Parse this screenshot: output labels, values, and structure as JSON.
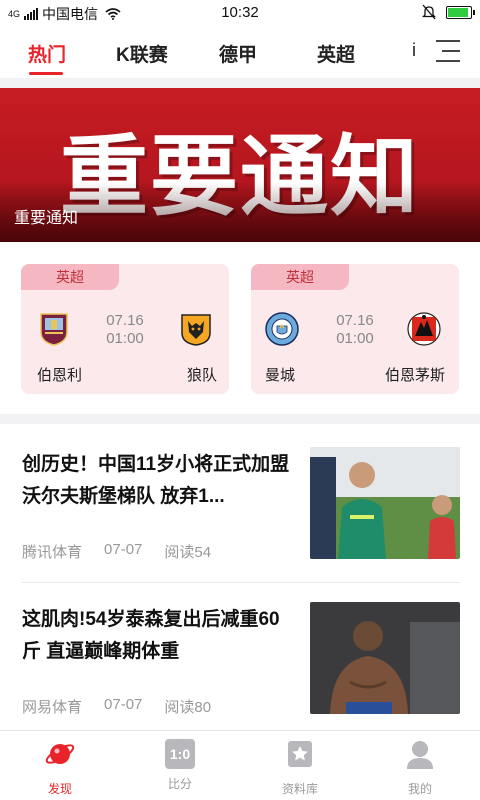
{
  "status_bar": {
    "network": "4G",
    "carrier": "中国电信",
    "time": "10:32"
  },
  "tabs": [
    {
      "label": "热门",
      "active": true
    },
    {
      "label": "K联赛",
      "active": false
    },
    {
      "label": "德甲",
      "active": false
    },
    {
      "label": "英超",
      "active": false
    },
    {
      "label": "i",
      "active": false
    }
  ],
  "banner": {
    "big_text": "重要通知",
    "caption": "重要通知"
  },
  "matches": [
    {
      "league": "英超",
      "home": "伯恩利",
      "away": "狼队",
      "date": "07.16",
      "time": "01:00"
    },
    {
      "league": "英超",
      "home": "曼城",
      "away": "伯恩茅斯",
      "date": "07.16",
      "time": "01:00"
    }
  ],
  "news": [
    {
      "title": "创历史！中国11岁小将正式加盟沃尔夫斯堡梯队 放弃1...",
      "source": "腾讯体育",
      "date": "07-07",
      "reads": "阅读54"
    },
    {
      "title": "这肌肉!54岁泰森复出后减重60斤 直逼巅峰期体重",
      "source": "网易体育",
      "date": "07-07",
      "reads": "阅读80"
    }
  ],
  "bottom_nav": [
    {
      "label": "发现",
      "icon": "planet-icon",
      "active": true
    },
    {
      "label": "比分",
      "icon": "scoreboard-icon",
      "active": false,
      "icon_text": "1:0"
    },
    {
      "label": "资料库",
      "icon": "star-book-icon",
      "active": false
    },
    {
      "label": "我的",
      "icon": "user-icon",
      "active": false
    }
  ],
  "colors": {
    "accent": "#e8242a",
    "card_bg": "#fbe9ec",
    "tag_bg": "#f5b7c1",
    "banner": "#c81c24"
  }
}
